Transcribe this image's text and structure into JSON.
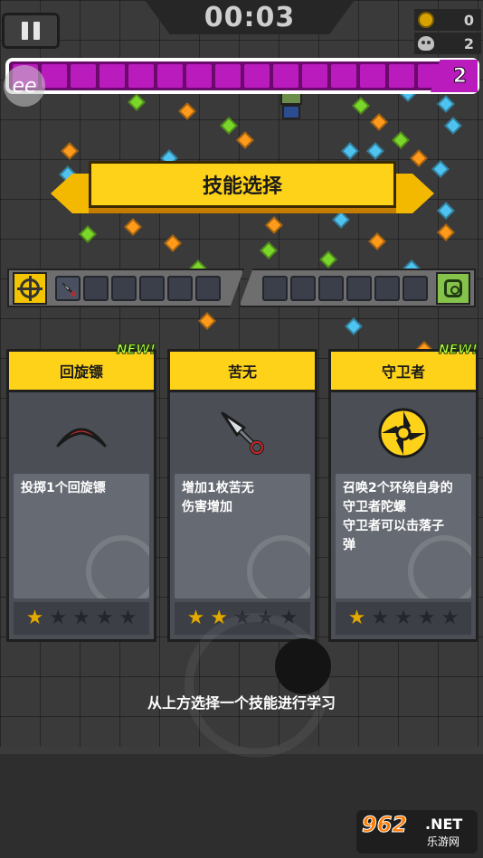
{
  "hud": {
    "timer": "00:03",
    "coins": "0",
    "kills": "2",
    "level": "2",
    "xp_segments": 16
  },
  "overlay_logo": "ee",
  "title": "技能选择",
  "slots": {
    "weapon_slot_count": 6,
    "passive_slot_count": 6,
    "weapon_icons": [
      "crosshair-icon",
      "kunai-icon"
    ],
    "passive_icon": "gear-box-icon"
  },
  "cards": [
    {
      "name": "回旋镖",
      "new": "NEW!",
      "description": "投掷1个回旋镖",
      "icon": "boomerang-icon",
      "stars_filled": 1,
      "stars_total": 5
    },
    {
      "name": "苦无",
      "new": "",
      "description": "增加1枚苦无\n伤害增加",
      "icon": "kunai-icon",
      "stars_filled": 2,
      "stars_total": 5
    },
    {
      "name": "守卫者",
      "new": "NEW!",
      "description": "召唤2个环绕自身的\n守卫者陀螺\n守卫者可以击落子\n弹",
      "icon": "shuriken-icon",
      "stars_filled": 1,
      "stars_total": 5
    }
  ],
  "hint": "从上方选择一个技能进行学习",
  "site_logo": {
    "main": "962",
    "net": ".NET",
    "cn": "乐游网"
  },
  "colors": {
    "accent_yellow": "#ffd21a",
    "xp_purple": "#b91bbd",
    "new_green": "#b7ff4a",
    "star_gold": "#e2a900"
  }
}
